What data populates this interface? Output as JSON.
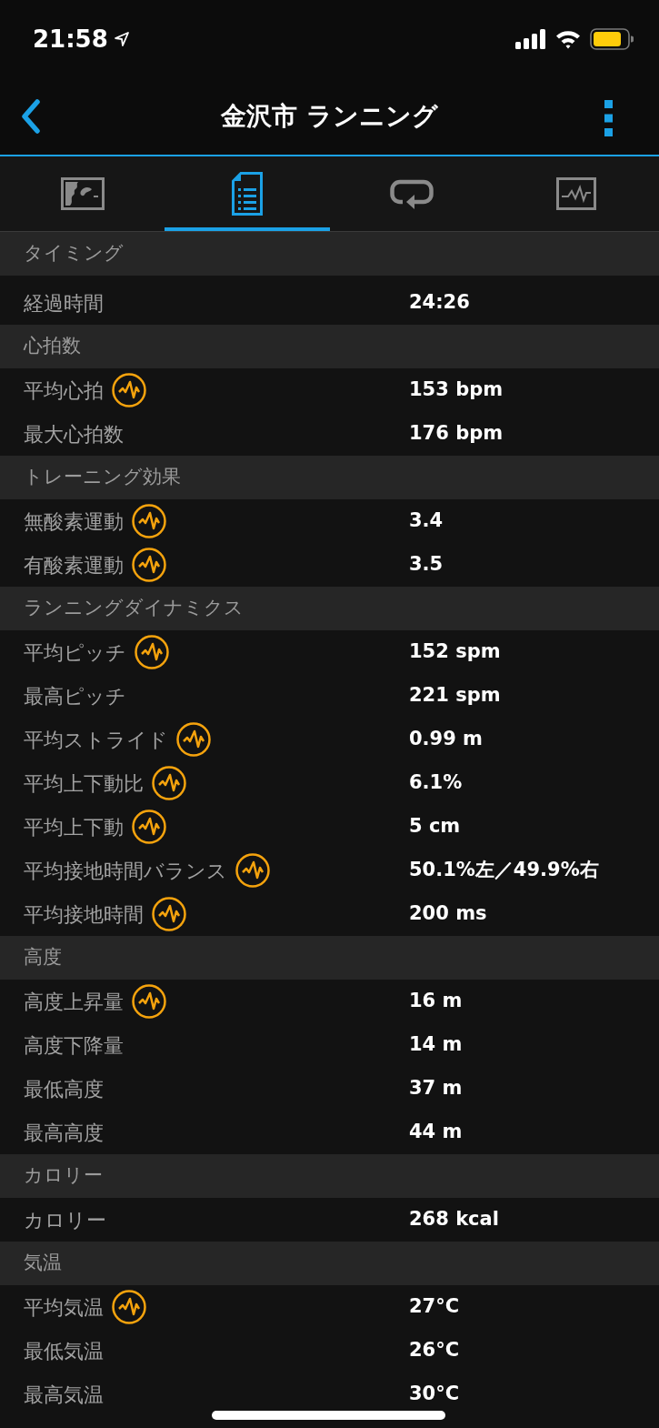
{
  "status_bar": {
    "time": "21:58"
  },
  "header": {
    "title": "金沢市 ランニング"
  },
  "tabs": [
    {
      "kind": "map",
      "selected": false
    },
    {
      "kind": "details",
      "selected": true
    },
    {
      "kind": "laps",
      "selected": false
    },
    {
      "kind": "charts",
      "selected": false
    }
  ],
  "sections": [
    {
      "title": "タイミング",
      "rows": [
        {
          "label": "経過時間",
          "value": "24:26",
          "has_chart": false
        }
      ]
    },
    {
      "title": "心拍数",
      "rows": [
        {
          "label": "平均心拍",
          "value": "153 bpm",
          "has_chart": true
        },
        {
          "label": "最大心拍数",
          "value": "176 bpm",
          "has_chart": false
        }
      ]
    },
    {
      "title": "トレーニング効果",
      "rows": [
        {
          "label": "無酸素運動",
          "value": "3.4",
          "has_chart": true
        },
        {
          "label": "有酸素運動",
          "value": "3.5",
          "has_chart": true
        }
      ]
    },
    {
      "title": "ランニングダイナミクス",
      "rows": [
        {
          "label": "平均ピッチ",
          "value": "152 spm",
          "has_chart": true
        },
        {
          "label": "最高ピッチ",
          "value": "221 spm",
          "has_chart": false
        },
        {
          "label": "平均ストライド",
          "value": "0.99 m",
          "has_chart": true
        },
        {
          "label": "平均上下動比",
          "value": "6.1%",
          "has_chart": true
        },
        {
          "label": "平均上下動",
          "value": "5 cm",
          "has_chart": true
        },
        {
          "label": "平均接地時間バランス",
          "value": "50.1%左／49.9%右",
          "has_chart": true
        },
        {
          "label": "平均接地時間",
          "value": "200 ms",
          "has_chart": true
        }
      ]
    },
    {
      "title": "高度",
      "rows": [
        {
          "label": "高度上昇量",
          "value": "16 m",
          "has_chart": true
        },
        {
          "label": "高度下降量",
          "value": "14 m",
          "has_chart": false
        },
        {
          "label": "最低高度",
          "value": "37 m",
          "has_chart": false
        },
        {
          "label": "最高高度",
          "value": "44 m",
          "has_chart": false
        }
      ]
    },
    {
      "title": "カロリー",
      "rows": [
        {
          "label": "カロリー",
          "value": "268 kcal",
          "has_chart": false
        }
      ]
    },
    {
      "title": "気温",
      "rows": [
        {
          "label": "平均気温",
          "value": "27°C",
          "has_chart": true
        },
        {
          "label": "最低気温",
          "value": "26°C",
          "has_chart": false
        },
        {
          "label": "最高気温",
          "value": "30°C",
          "has_chart": false
        }
      ]
    }
  ]
}
